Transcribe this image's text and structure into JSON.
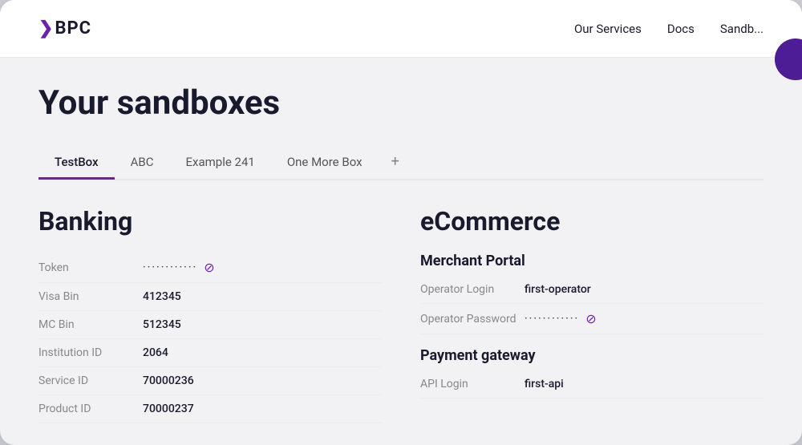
{
  "header": {
    "logo_chevron": "❯",
    "logo_text": "BPC",
    "nav": [
      {
        "label": "Our Services"
      },
      {
        "label": "Docs"
      },
      {
        "label": "Sandb..."
      }
    ]
  },
  "page": {
    "title": "Your sandboxes"
  },
  "tabs": [
    {
      "label": "TestBox",
      "active": true
    },
    {
      "label": "ABC",
      "active": false
    },
    {
      "label": "Example 241",
      "active": false
    },
    {
      "label": "One More Box",
      "active": false
    },
    {
      "label": "+",
      "is_add": true
    }
  ],
  "banking": {
    "title": "Banking",
    "fields": [
      {
        "label": "Token",
        "value": "············",
        "has_eye": true
      },
      {
        "label": "Visa Bin",
        "value": "412345",
        "has_eye": false
      },
      {
        "label": "MC Bin",
        "value": "512345",
        "has_eye": false
      },
      {
        "label": "Institution ID",
        "value": "2064",
        "has_eye": false
      },
      {
        "label": "Service ID",
        "value": "70000236",
        "has_eye": false
      },
      {
        "label": "Product ID",
        "value": "70000237",
        "has_eye": false
      }
    ]
  },
  "ecommerce": {
    "title": "eCommerce",
    "merchant_portal": {
      "subtitle": "Merchant Portal",
      "fields": [
        {
          "label": "Operator Login",
          "value": "first-operator",
          "has_eye": false
        },
        {
          "label": "Operator Password",
          "value": "············",
          "has_eye": true
        }
      ]
    },
    "payment_gateway": {
      "subtitle": "Payment gateway",
      "fields": [
        {
          "label": "API Login",
          "value": "first-api",
          "has_eye": false
        }
      ]
    }
  }
}
